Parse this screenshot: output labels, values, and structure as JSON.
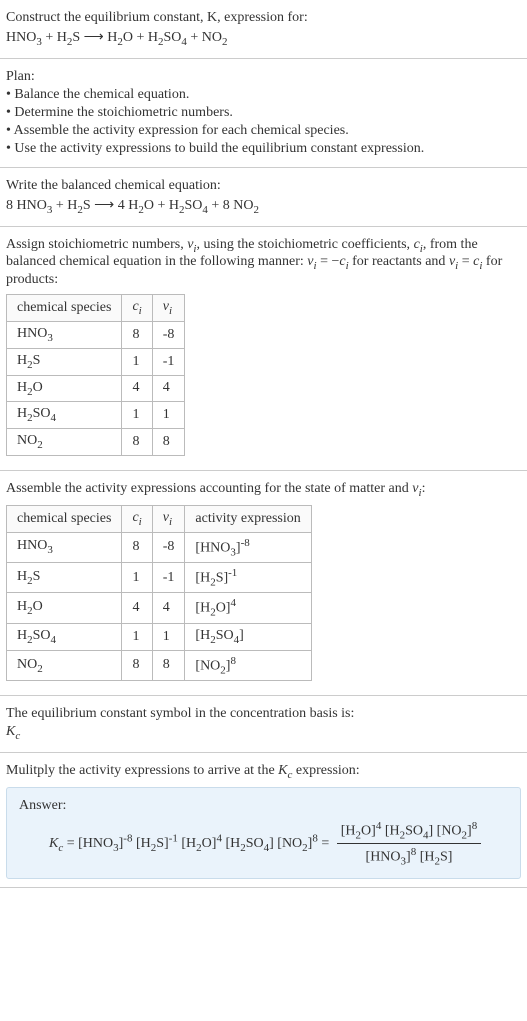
{
  "header": {
    "prompt_line1": "Construct the equilibrium constant, K, expression for:",
    "equation_unbalanced_html": "HNO<sub>3</sub> + H<sub>2</sub>S <span class='arrow'>⟶</span> H<sub>2</sub>O + H<sub>2</sub>SO<sub>4</sub> + NO<sub>2</sub>"
  },
  "plan": {
    "title": "Plan:",
    "items": [
      "• Balance the chemical equation.",
      "• Determine the stoichiometric numbers.",
      "• Assemble the activity expression for each chemical species.",
      "• Use the activity expressions to build the equilibrium constant expression."
    ]
  },
  "balanced": {
    "title": "Write the balanced chemical equation:",
    "equation_html": "8 HNO<sub>3</sub> + H<sub>2</sub>S <span class='arrow'>⟶</span> 4 H<sub>2</sub>O + H<sub>2</sub>SO<sub>4</sub> + 8 NO<sub>2</sub>"
  },
  "stoich": {
    "intro_html": "Assign stoichiometric numbers, <span class='italic'>ν<sub>i</sub></span>, using the stoichiometric coefficients, <span class='italic'>c<sub>i</sub></span>, from the balanced chemical equation in the following manner: <span class='italic'>ν<sub>i</sub></span> = −<span class='italic'>c<sub>i</sub></span> for reactants and <span class='italic'>ν<sub>i</sub></span> = <span class='italic'>c<sub>i</sub></span> for products:",
    "headers": {
      "species": "chemical species",
      "ci_html": "<span class='italic'>c<sub>i</sub></span>",
      "vi_html": "<span class='italic'>ν<sub>i</sub></span>"
    },
    "rows": [
      {
        "species_html": "HNO<sub>3</sub>",
        "ci": "8",
        "vi": "-8"
      },
      {
        "species_html": "H<sub>2</sub>S",
        "ci": "1",
        "vi": "-1"
      },
      {
        "species_html": "H<sub>2</sub>O",
        "ci": "4",
        "vi": "4"
      },
      {
        "species_html": "H<sub>2</sub>SO<sub>4</sub>",
        "ci": "1",
        "vi": "1"
      },
      {
        "species_html": "NO<sub>2</sub>",
        "ci": "8",
        "vi": "8"
      }
    ]
  },
  "activity": {
    "intro_html": "Assemble the activity expressions accounting for the state of matter and <span class='italic'>ν<sub>i</sub></span>:",
    "headers": {
      "species": "chemical species",
      "ci_html": "<span class='italic'>c<sub>i</sub></span>",
      "vi_html": "<span class='italic'>ν<sub>i</sub></span>",
      "act": "activity expression"
    },
    "rows": [
      {
        "species_html": "HNO<sub>3</sub>",
        "ci": "8",
        "vi": "-8",
        "act_html": "[HNO<sub>3</sub>]<sup>-8</sup>"
      },
      {
        "species_html": "H<sub>2</sub>S",
        "ci": "1",
        "vi": "-1",
        "act_html": "[H<sub>2</sub>S]<sup>-1</sup>"
      },
      {
        "species_html": "H<sub>2</sub>O",
        "ci": "4",
        "vi": "4",
        "act_html": "[H<sub>2</sub>O]<sup>4</sup>"
      },
      {
        "species_html": "H<sub>2</sub>SO<sub>4</sub>",
        "ci": "1",
        "vi": "1",
        "act_html": "[H<sub>2</sub>SO<sub>4</sub>]"
      },
      {
        "species_html": "NO<sub>2</sub>",
        "ci": "8",
        "vi": "8",
        "act_html": "[NO<sub>2</sub>]<sup>8</sup>"
      }
    ]
  },
  "symbol": {
    "line1": "The equilibrium constant symbol in the concentration basis is:",
    "kc_html": "<span class='italic'>K<sub>c</sub></span>"
  },
  "final": {
    "intro_html": "Mulitply the activity expressions to arrive at the <span class='italic'>K<sub>c</sub></span> expression:",
    "answer_label": "Answer:",
    "lhs_html": "<span class='italic'>K<sub>c</sub></span> = [HNO<sub>3</sub>]<sup>-8</sup> [H<sub>2</sub>S]<sup>-1</sup> [H<sub>2</sub>O]<sup>4</sup> [H<sub>2</sub>SO<sub>4</sub>] [NO<sub>2</sub>]<sup>8</sup> = ",
    "frac_num_html": "[H<sub>2</sub>O]<sup>4</sup> [H<sub>2</sub>SO<sub>4</sub>] [NO<sub>2</sub>]<sup>8</sup>",
    "frac_den_html": "[HNO<sub>3</sub>]<sup>8</sup> [H<sub>2</sub>S]"
  }
}
